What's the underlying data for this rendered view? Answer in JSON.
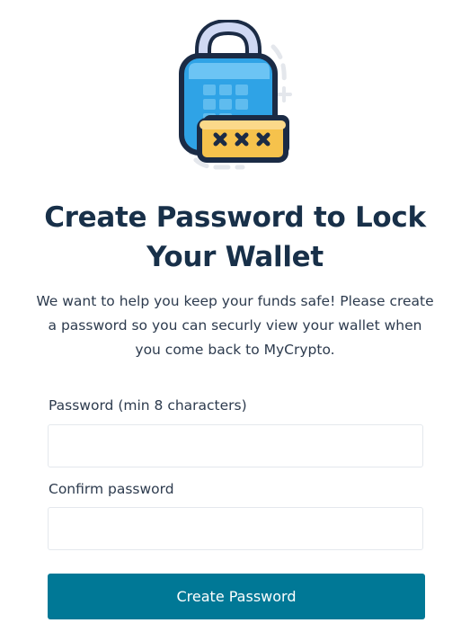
{
  "header": {
    "illustration_icon": "padlock-password-icon",
    "title": "Create Password to Lock Your Wallet",
    "description": "We want to help you keep your funds safe! Please create a password so you can securly view your wallet when you come back to MyCrypto."
  },
  "form": {
    "password_label": "Password (min 8 characters)",
    "password_value": "",
    "confirm_label": "Confirm password",
    "confirm_value": "",
    "submit_label": "Create Password"
  },
  "colors": {
    "title": "#183049",
    "button_bg": "#007896",
    "button_text": "#ffffff",
    "lock_body": "#2fa3e6",
    "lock_shackle": "#cfd8f3",
    "card": "#f6c24c",
    "outline": "#1b2b45"
  }
}
